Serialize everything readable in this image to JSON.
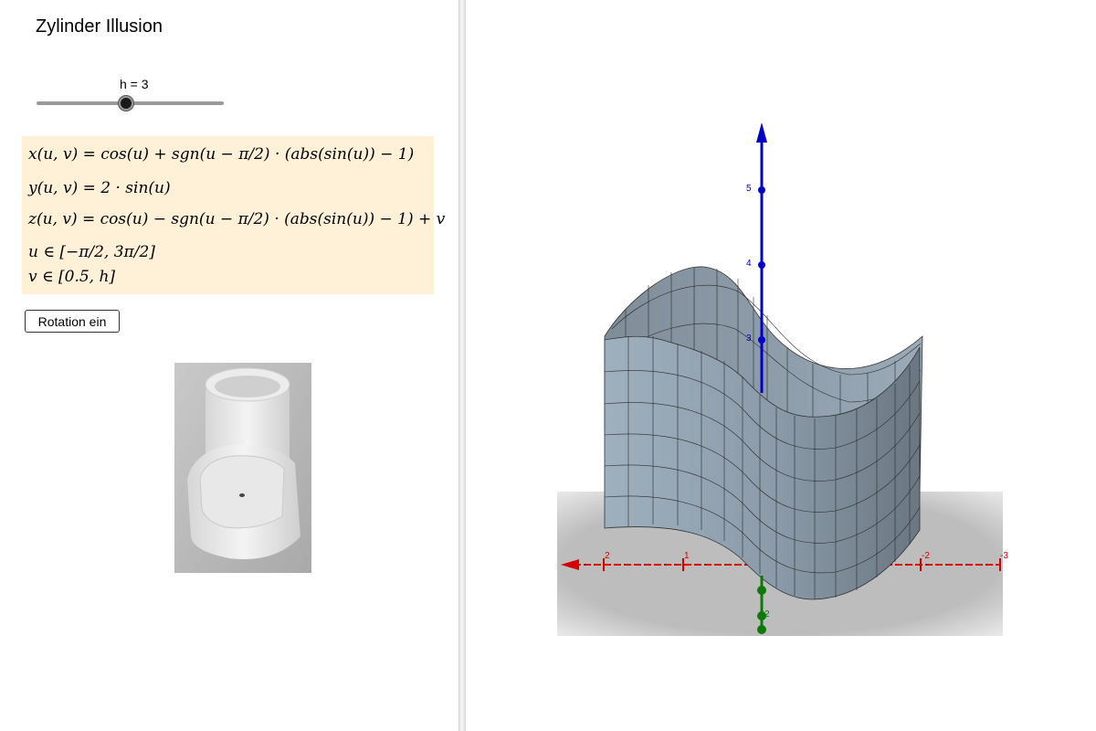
{
  "title": "Zylinder Illusion",
  "slider": {
    "label": "h = 3",
    "value": 3,
    "min": 0.5,
    "max": 5,
    "fraction": 0.48
  },
  "formulas": [
    "x(u, v) = cos(u) + sgn(u − π/2) · (abs(sin(u)) − 1)",
    "y(u, v) = 2 · sin(u)",
    "z(u, v) = cos(u) − sgn(u − π/2) · (abs(sin(u)) − 1) + v",
    "u ∈ [−π/2, 3π/2]",
    "v ∈ [0.5, h]"
  ],
  "button": {
    "label": "Rotation ein"
  },
  "colors": {
    "surface": "#8e9eac",
    "surface_dark": "#6f7c87",
    "x_axis": "#d40000",
    "y_axis": "#0b7a0b",
    "z_axis": "#0000c8",
    "formula_bg": "#fff0d8"
  },
  "axes": {
    "z_ticks": [
      "5",
      "4",
      "3"
    ],
    "x_ticks": [
      "2",
      "1",
      "-2",
      "-3"
    ],
    "y_ticks": [
      "2"
    ]
  }
}
